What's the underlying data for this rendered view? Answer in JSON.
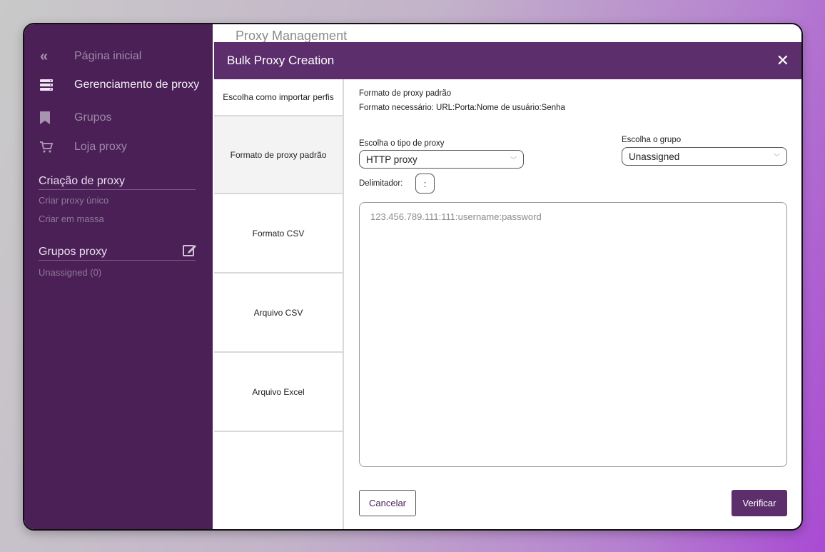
{
  "sidebar": {
    "collapse_icon": "double-chevron-left-icon",
    "items": [
      {
        "label": "Página inicial",
        "icon": "double-chevron-left-icon"
      },
      {
        "label": "Gerenciamento de proxy",
        "icon": "server-icon"
      },
      {
        "label": "Grupos",
        "icon": "bookmark-icon"
      },
      {
        "label": "Loja proxy",
        "icon": "cart-icon"
      }
    ],
    "creation_title": "Criação de proxy",
    "creation_links": [
      "Criar proxy único",
      "Criar em massa"
    ],
    "groups_title": "Grupos proxy",
    "groups": [
      "Unassigned (0)"
    ]
  },
  "main": {
    "title": "Proxy Management"
  },
  "modal": {
    "title": "Bulk Proxy Creation",
    "close_label": "✕",
    "tabs": {
      "header": "Escolha como importar perfis",
      "items": [
        "Formato de proxy padrão",
        "Formato CSV",
        "Arquivo CSV",
        "Arquivo Excel"
      ]
    },
    "info_title": "Formato de proxy padrão",
    "info_format": "Formato necessário: URL:Porta:Nome de usuário:Senha",
    "proxy_type_label": "Escolha o tipo de proxy",
    "proxy_type_value": "HTTP proxy",
    "group_label": "Escolha o grupo",
    "group_value": "Unassigned",
    "delimiter_label": "Delimitador:",
    "delimiter_value": ":",
    "textarea_placeholder": "123.456.789.111:111:username:password",
    "cancel_label": "Cancelar",
    "verify_label": "Verificar"
  },
  "colors": {
    "sidebar_bg": "#4b2057",
    "accent": "#5c2f6c"
  }
}
